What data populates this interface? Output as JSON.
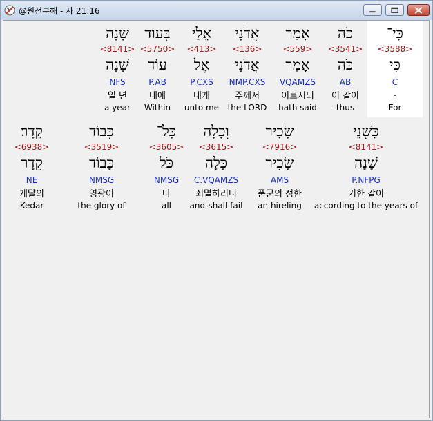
{
  "window": {
    "title": "@원전분해 - 사 21:16",
    "icon": "app-icon",
    "controls": [
      "minimize-icon",
      "maximize-icon",
      "close-icon"
    ]
  },
  "rows": [
    {
      "words": [
        {
          "surface": "כִּי־",
          "strong": "<3588>",
          "lemma": "כִּי",
          "parse": "C",
          "korean": ".",
          "english": "For",
          "highlighted": true
        },
        {
          "surface": "כֹה",
          "strong": "<3541>",
          "lemma": "כֹּה",
          "parse": "AB",
          "korean": "이 같이",
          "english": "thus"
        },
        {
          "surface": "אָמַר",
          "strong": "<559>",
          "lemma": "אָמַר",
          "parse": "VQAMZS",
          "korean": "이르시되",
          "english": "hath said"
        },
        {
          "surface": "אֲדֹנָי",
          "strong": "<136>",
          "lemma": "אֲדֹנָי",
          "parse": "NMP.CXS",
          "korean": "주께서",
          "english": "the LORD"
        },
        {
          "surface": "אֵלַי",
          "strong": "<413>",
          "lemma": "אֶל",
          "parse": "P.CXS",
          "korean": "내게",
          "english": "unto me"
        },
        {
          "surface": "בְּעוֹד",
          "strong": "<5750>",
          "lemma": "עוֹד",
          "parse": "P.AB",
          "korean": "내에",
          "english": "Within"
        },
        {
          "surface": "שָׁנָה",
          "strong": "<8141>",
          "lemma": "שָׁנָה",
          "parse": "NFS",
          "korean": "일 년",
          "english": "a year"
        }
      ]
    },
    {
      "words": [
        {
          "surface": "כִּשְׁנֵי",
          "strong": "<8141>",
          "lemma": "שָׁנָה",
          "parse": "P.NFPG",
          "korean": "기한 같이",
          "english": "according to the years of"
        },
        {
          "surface": "שָׂכִיר",
          "strong": "<7916>",
          "lemma": "שָׂכִיר",
          "parse": "AMS",
          "korean": "품군의 정한",
          "english": "an hireling"
        },
        {
          "surface": "וְכָלָה",
          "strong": "<3615>",
          "lemma": "כָּלָה",
          "parse": "C.VQAMZS",
          "korean": "쇠멸하리니",
          "english": "and-shall fail"
        },
        {
          "surface": "כָּל־",
          "strong": "<3605>",
          "lemma": "כֹּל",
          "parse": "NMSG",
          "korean": "다",
          "english": "all"
        },
        {
          "surface": "כְּבוֹד",
          "strong": "<3519>",
          "lemma": "כָּבוֹד",
          "parse": "NMSG",
          "korean": "영광이",
          "english": "the glory of"
        },
        {
          "surface": "קֵדָר׃",
          "strong": "<6938>",
          "lemma": "קֵדָר",
          "parse": "NE",
          "korean": "게달의",
          "english": "Kedar"
        }
      ]
    }
  ],
  "colors": {
    "strong": "#9b1a1a",
    "parse": "#1a2fb8",
    "highlight": "#ffffff"
  }
}
